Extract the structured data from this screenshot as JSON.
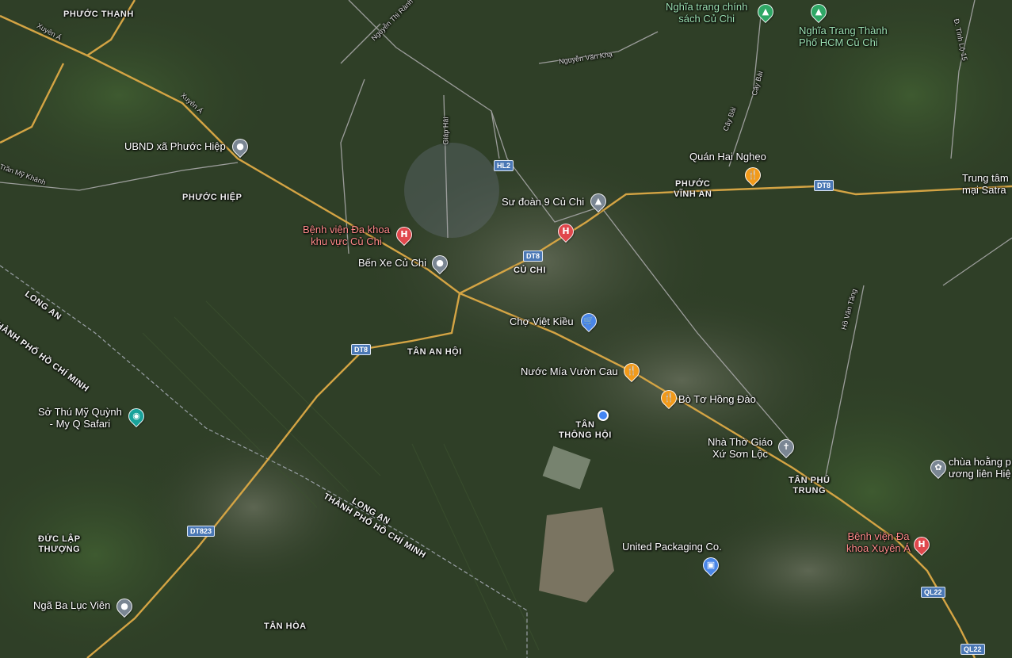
{
  "map": {
    "colors": {
      "satellite_dark": "#2b3a24",
      "road_major": "#d4a444",
      "road_minor": "#b8b8b8",
      "hospital": "#e0474c",
      "food": "#f29a1a",
      "shop": "#4a86e8",
      "landmark": "#7a8693",
      "location": "#4285f4"
    },
    "areas": {
      "phuoc_thanh": "PHƯỚC THẠNH",
      "phuoc_hiep": "PHƯỚC HIỆP",
      "phuoc_vinh_an": "PHƯỚC\nVĨNH AN",
      "cu_chi": "CỦ CHI",
      "tan_an_hoi": "TÂN AN HỘI",
      "tan_thong_hoi": "TÂN\nTHÔNG HỘI",
      "tan_phu_trung": "TÂN PHÚ\nTRUNG",
      "duc_lap_thuong": "ĐỨC LẬP\nTHƯỢNG",
      "tan_hoa": "TÂN HÒA"
    },
    "provinces": {
      "hcm_left": "THÀNH PHỐ HỒ CHÍ MINH",
      "long_an_left": "LONG AN",
      "hcm_bottom": "THÀNH PHỐ HỒ CHÍ MINH",
      "long_an_bottom": "LONG AN"
    },
    "roads": {
      "xuyen_a_1": "Xuyên Á",
      "xuyen_a_2": "Xuyên Á",
      "nguyen_thi_rang": "Nguyễn Thị Rành",
      "nguyen_van_kha": "Nguyễn Văn Khạ",
      "giap_hai": "Giáp Hải",
      "cay_bai_1": "Cây Bài",
      "cay_bai_2": "Cây Bài",
      "tinh_lo_15": "Đ. Tỉnh Lộ 15",
      "ho_van_tang": "Hồ Văn Tăng",
      "phuoc_my_khanh": "Trần Mỹ Khánh"
    },
    "shields": {
      "hl2": "HL2",
      "dt8_center": "DT8",
      "dt8_left": "DT8",
      "dt8_right": "DT8",
      "dt823": "DT823",
      "ql22_a": "QL22",
      "ql22_b": "QL22"
    },
    "pois": {
      "nghia_trang_chinh_sach": "Nghĩa trang chính\nsách Củ Chi",
      "nghia_trang_tp": "Nghĩa Trang Thành\nPhố HCM Củ Chi",
      "ubnd_phuoc_hiep": "UBND xã Phước Hiệp",
      "quan_hai_ngheo": "Quán Hai Nghẹo",
      "trung_tam_satra": "Trung tâm\nmại Satra",
      "su_doan_9": "Sư đoàn 9 Củ Chi",
      "benh_vien_cu_chi": "Bệnh viện Đa khoa\nkhu vực Củ Chi",
      "ben_xe_cu_chi": "Bến Xe Củ Chi",
      "cho_viet_kieu": "Chợ Việt Kiều",
      "nuoc_mia": "Nước Mía Vườn Cau",
      "bo_to": "Bò Tơ Hồng Đào",
      "so_thu": "Sở Thú Mỹ Quỳnh\n- My Q Safari",
      "nha_tho": "Nhà Thờ Giáo\nXứ Sơn Lộc",
      "chua_hoang": "chùa hoằng p\nương liên Hiệ",
      "benh_vien_xuyen_a": "Bệnh viện Đa\nkhoa Xuyên Á",
      "united_packaging": "United Packaging Co.",
      "nga_ba_luc_vien": "Ngã Ba Lục Viên"
    },
    "icons": {
      "hospital": "H",
      "food": "🍴",
      "landmark": "●",
      "shop": "🛒",
      "cemetery": "▲",
      "church": "✝",
      "temple": "✿",
      "zoo": "◉",
      "school": "▲",
      "package": "▣"
    }
  }
}
